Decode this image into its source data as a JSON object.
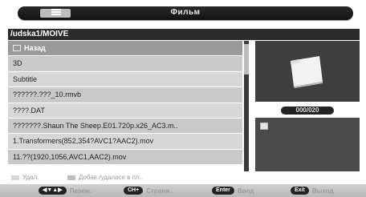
{
  "header": {
    "title": "Фильм"
  },
  "path": "/udska1/MOIVE",
  "files": [
    {
      "label": "Назад",
      "selected": true,
      "icon": "back-icon"
    },
    {
      "label": "3D"
    },
    {
      "label": "Subtitle"
    },
    {
      "label": "??????.???_10.rmvb"
    },
    {
      "label": "????.DAT"
    },
    {
      "label": "???????.Shaun The Sheep.E01.720p.x26_AC3.m.."
    },
    {
      "label": "1.Transformers(852,354?AVC1?AAC2).mov"
    },
    {
      "label": "11.??(1920,1056,AVC1,AAC2).mov"
    }
  ],
  "preview": {
    "counter": "000/020",
    "icon": "folder-icon"
  },
  "legend": {
    "item1": "Удал.",
    "item2": "Добав./удаласе в пл..",
    "color1": "#d6d6d6",
    "color2": "#bdbdbd"
  },
  "bottom": {
    "hint1_key": "◀▼▲▶",
    "hint1_label": "Перем.",
    "hint2_key": "CH+",
    "hint2_label": "Страни..",
    "hint3_key": "Enter",
    "hint3_label": "Ввод",
    "hint4_key": "Exit",
    "hint4_label": "Выход"
  }
}
